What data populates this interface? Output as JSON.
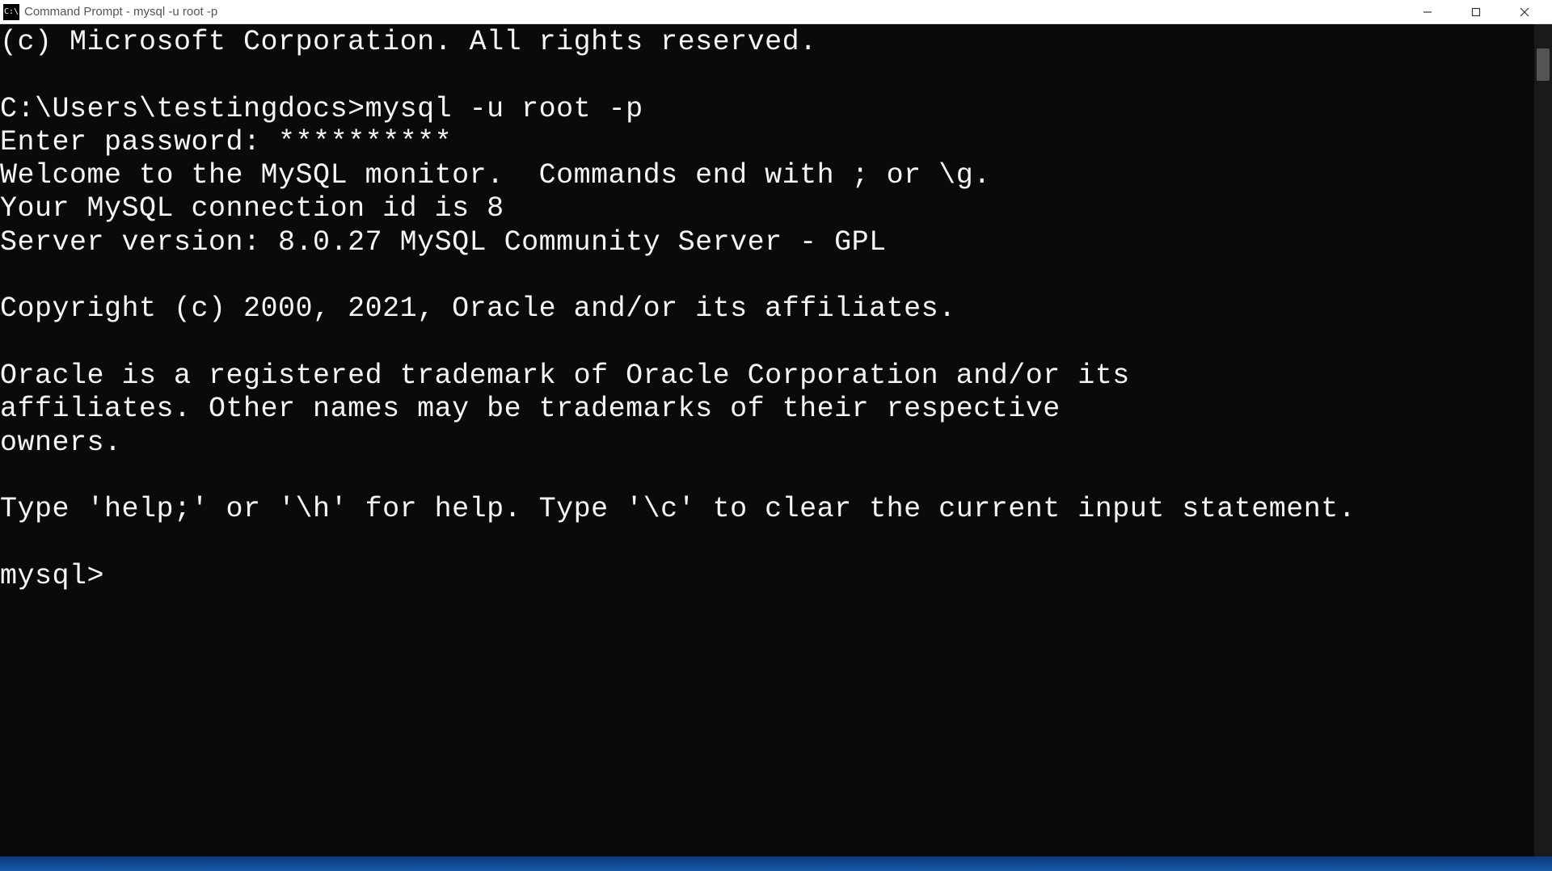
{
  "window": {
    "title": "Command Prompt - mysql  -u root -p",
    "icon_label": "C:\\"
  },
  "terminal": {
    "lines": {
      "l0": "(c) Microsoft Corporation. All rights reserved.",
      "l1": "",
      "l2": "C:\\Users\\testingdocs>mysql -u root -p",
      "l3": "Enter password: **********",
      "l4": "Welcome to the MySQL monitor.  Commands end with ; or \\g.",
      "l5": "Your MySQL connection id is 8",
      "l6": "Server version: 8.0.27 MySQL Community Server - GPL",
      "l7": "",
      "l8": "Copyright (c) 2000, 2021, Oracle and/or its affiliates.",
      "l9": "",
      "l10": "Oracle is a registered trademark of Oracle Corporation and/or its",
      "l11": "affiliates. Other names may be trademarks of their respective",
      "l12": "owners.",
      "l13": "",
      "l14": "Type 'help;' or '\\h' for help. Type '\\c' to clear the current input statement.",
      "l15": "",
      "l16": "mysql>"
    }
  }
}
